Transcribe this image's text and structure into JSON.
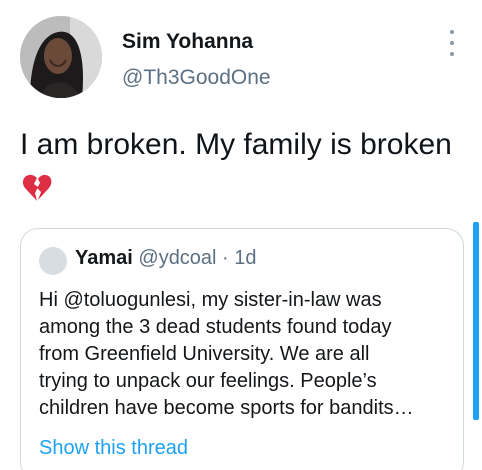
{
  "tweet": {
    "author_name": "Sim Yohanna",
    "author_handle": "@Th3GoodOne",
    "text": "I am broken. My family is broken"
  },
  "quoted_tweet": {
    "author_name": "Yamai",
    "author_handle": "@ydcoal",
    "meta": " @ydcoal · 1d",
    "body": "Hi @toluogunlesi, my sister-in-law was\namong the 3 dead students  found today\nfrom Greenfield University. We are all\ntrying to unpack our feelings. People’s\nchildren have become sports for bandits…",
    "show_thread_label": "Show this thread"
  },
  "icons": {
    "more": "more-vertical-icon",
    "emoji": "broken-heart-icon"
  },
  "colors": {
    "link": "#1da1f2",
    "muted": "#5b7083",
    "broken_heart": "#dd2e44",
    "border": "#cfd9de"
  }
}
